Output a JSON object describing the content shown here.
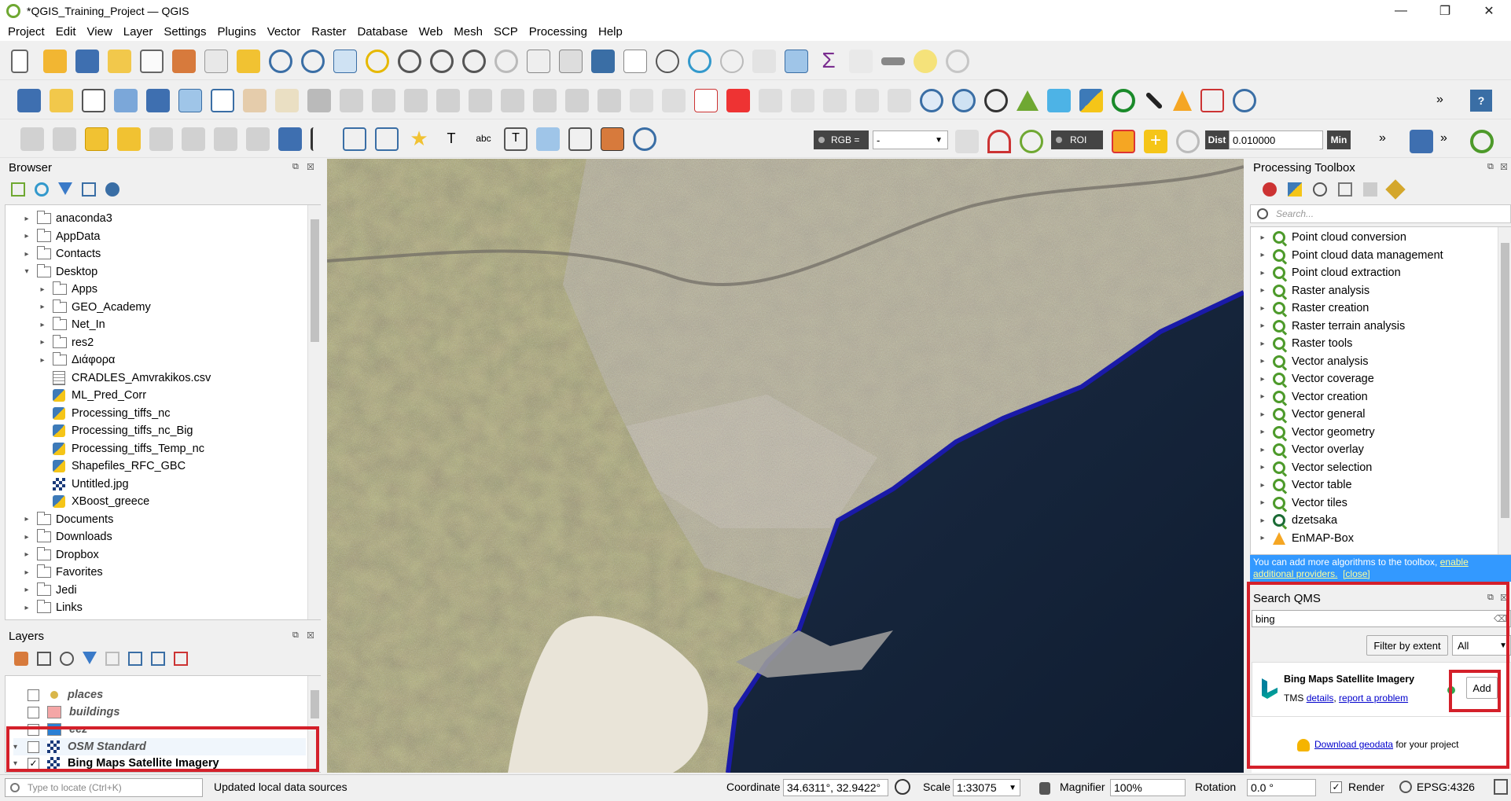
{
  "window": {
    "title": "*QGIS_Training_Project — QGIS",
    "minimize": "—",
    "maximize": "❐",
    "close": "✕"
  },
  "menu": [
    "Project",
    "Edit",
    "View",
    "Layer",
    "Settings",
    "Plugins",
    "Vector",
    "Raster",
    "Database",
    "Web",
    "Mesh",
    "SCP",
    "Processing",
    "Help"
  ],
  "toolbar3": {
    "rgb_label": "RGB =",
    "rgb_value": "-",
    "roi_label": "ROI",
    "dist_label": "Dist",
    "dist_value": "0.010000",
    "min_label": "Min"
  },
  "browser": {
    "title": "Browser",
    "items": [
      {
        "label": "anaconda3",
        "icon": "folder",
        "level": 0,
        "arrow": "▸"
      },
      {
        "label": "AppData",
        "icon": "folder",
        "level": 0,
        "arrow": "▸"
      },
      {
        "label": "Contacts",
        "icon": "folder",
        "level": 0,
        "arrow": "▸"
      },
      {
        "label": "Desktop",
        "icon": "folder",
        "level": 0,
        "arrow": "▾"
      },
      {
        "label": "Apps",
        "icon": "folder",
        "level": 1,
        "arrow": "▸"
      },
      {
        "label": "GEO_Academy",
        "icon": "folder",
        "level": 1,
        "arrow": "▸"
      },
      {
        "label": "Net_In",
        "icon": "folder",
        "level": 1,
        "arrow": "▸"
      },
      {
        "label": "res2",
        "icon": "folder",
        "level": 1,
        "arrow": "▸"
      },
      {
        "label": "Διάφορα",
        "icon": "folder",
        "level": 1,
        "arrow": "▸"
      },
      {
        "label": "CRADLES_Amvrakikos.csv",
        "icon": "csv",
        "level": 1,
        "arrow": ""
      },
      {
        "label": "ML_Pred_Corr",
        "icon": "python",
        "level": 1,
        "arrow": ""
      },
      {
        "label": "Processing_tiffs_nc",
        "icon": "python",
        "level": 1,
        "arrow": ""
      },
      {
        "label": "Processing_tiffs_nc_Big",
        "icon": "python",
        "level": 1,
        "arrow": ""
      },
      {
        "label": "Processing_tiffs_Temp_nc",
        "icon": "python",
        "level": 1,
        "arrow": ""
      },
      {
        "label": "Shapefiles_RFC_GBC",
        "icon": "python",
        "level": 1,
        "arrow": ""
      },
      {
        "label": "Untitled.jpg",
        "icon": "jpg",
        "level": 1,
        "arrow": ""
      },
      {
        "label": "XBoost_greece",
        "icon": "python",
        "level": 1,
        "arrow": ""
      },
      {
        "label": "Documents",
        "icon": "folder",
        "level": 0,
        "arrow": "▸"
      },
      {
        "label": "Downloads",
        "icon": "folder",
        "level": 0,
        "arrow": "▸"
      },
      {
        "label": "Dropbox",
        "icon": "folder",
        "level": 0,
        "arrow": "▸"
      },
      {
        "label": "Favorites",
        "icon": "folder",
        "level": 0,
        "arrow": "▸"
      },
      {
        "label": "Jedi",
        "icon": "folder",
        "level": 0,
        "arrow": "▸"
      },
      {
        "label": "Links",
        "icon": "folder",
        "level": 0,
        "arrow": "▸"
      }
    ]
  },
  "layers": {
    "title": "Layers",
    "items": [
      {
        "label": "places",
        "checked": false,
        "style": "italic",
        "swatch": "point",
        "color": "#d9b64a"
      },
      {
        "label": "buildings",
        "checked": false,
        "style": "italic",
        "swatch": "fill",
        "color": "#f4a6a6"
      },
      {
        "label": "eez",
        "checked": false,
        "style": "italic",
        "swatch": "fill",
        "color": "#2a7fd4"
      },
      {
        "label": "OSM Standard",
        "checked": false,
        "style": "italic",
        "swatch": "raster",
        "color": "#1a3a7a"
      },
      {
        "label": "Bing Maps Satellite Imagery",
        "checked": true,
        "style": "bold",
        "swatch": "raster",
        "color": "#1a3a7a"
      }
    ]
  },
  "toolbox": {
    "title": "Processing Toolbox",
    "search_placeholder": "Search...",
    "items": [
      "Point cloud conversion",
      "Point cloud data management",
      "Point cloud extraction",
      "Raster analysis",
      "Raster creation",
      "Raster terrain analysis",
      "Raster tools",
      "Vector analysis",
      "Vector coverage",
      "Vector creation",
      "Vector general",
      "Vector geometry",
      "Vector overlay",
      "Vector selection",
      "Vector table",
      "Vector tiles",
      "dzetsaka",
      "EnMAP-Box"
    ],
    "info_text": "You can add more algorithms to the toolbox,",
    "info_link1": "enable additional providers.",
    "info_close": "[close]"
  },
  "qms": {
    "title": "Search QMS",
    "search_value": "bing",
    "filter_button": "Filter by extent",
    "filter_select": "All",
    "result_title": "Bing Maps Satellite Imagery",
    "result_type": "TMS",
    "details_link": "details",
    "report_link": "report a problem",
    "add_button": "Add",
    "download_link": "Download geodata",
    "download_suffix": "for your project"
  },
  "status": {
    "locate_placeholder": "Type to locate (Ctrl+K)",
    "message": "Updated local data sources",
    "coordinate_label": "Coordinate",
    "coordinate_value": "34.6311°, 32.9422°",
    "scale_label": "Scale",
    "scale_value": "1:33075",
    "magnifier_label": "Magnifier",
    "magnifier_value": "100%",
    "rotation_label": "Rotation",
    "rotation_value": "0.0 °",
    "render_label": "Render",
    "crs": "EPSG:4326"
  },
  "colors": {
    "accent_red": "#d4202a",
    "info_blue": "#3399ff",
    "qgis_green": "#6fa832"
  }
}
